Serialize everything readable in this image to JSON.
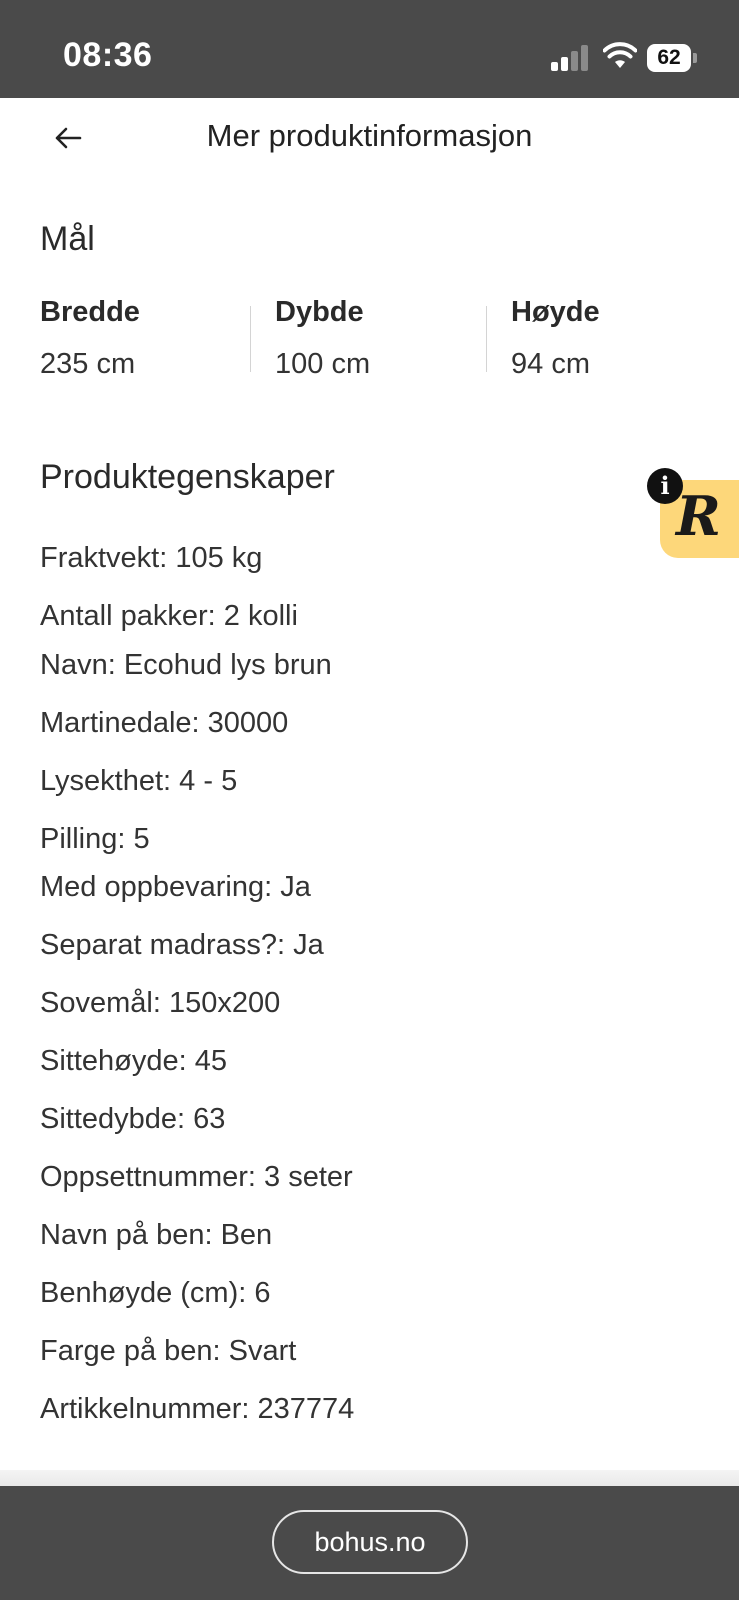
{
  "status_bar": {
    "time": "08:36",
    "battery": "62",
    "icons": [
      "cellular-signal-icon",
      "wifi-icon",
      "battery-icon"
    ]
  },
  "header": {
    "title": "Mer produktinformasjon",
    "back_icon": "arrow-left-icon"
  },
  "dimensions": {
    "title": "Mål",
    "items": [
      {
        "label": "Bredde",
        "value": "235 cm"
      },
      {
        "label": "Dybde",
        "value": "100 cm"
      },
      {
        "label": "Høyde",
        "value": "94 cm"
      }
    ]
  },
  "properties": {
    "title": "Produktegenskaper",
    "items": [
      "Fraktvekt: 105 kg",
      "Antall pakker: 2 kolli",
      "Navn: Ecohud lys brun",
      "Martinedale: 30000",
      "Lysekthet: 4 - 5",
      "Pilling: 5",
      "Med oppbevaring: Ja",
      "Separat madrass?: Ja",
      "Sovemål: 150x200",
      "Sittehøyde: 45",
      "Sittedybde: 63",
      "Oppsettnummer: 3 seter",
      "Navn på ben: Ben",
      "Benhøyde (cm): 6",
      "Farge på ben: Svart",
      "Artikkelnummer: 237774"
    ]
  },
  "badge": {
    "letter": "R",
    "info": "i",
    "color": "#fdd77a"
  },
  "browser_bar": {
    "url": "bohus.no"
  },
  "colors": {
    "chrome": "#4a4a4a",
    "text": "#2b2b2b"
  }
}
